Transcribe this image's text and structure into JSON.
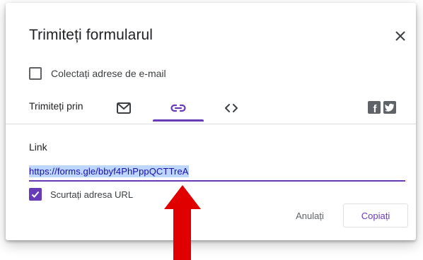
{
  "dialog": {
    "title": "Trimiteți formularul",
    "collect_emails_label": "Colectați adrese de e-mail",
    "collect_emails_checked": false,
    "send_via_label": "Trimiteți prin",
    "tabs": [
      {
        "icon": "email-icon",
        "selected": false
      },
      {
        "icon": "link-icon",
        "selected": true
      },
      {
        "icon": "embed-code-icon",
        "selected": false
      }
    ],
    "social": [
      {
        "icon": "facebook-icon",
        "glyph": "f"
      },
      {
        "icon": "twitter-icon",
        "glyph": "t"
      }
    ],
    "link_heading": "Link",
    "link_url": "https://forms.gle/bbyf4PhPppQCTTreA",
    "shorten_label": "Scurtați adresa URL",
    "shorten_checked": true,
    "cancel_label": "Anulați",
    "copy_label": "Copiați"
  },
  "colors": {
    "accent": "#673ab7",
    "selection": "#bcd7fb",
    "annotation_arrow": "#e00000"
  }
}
